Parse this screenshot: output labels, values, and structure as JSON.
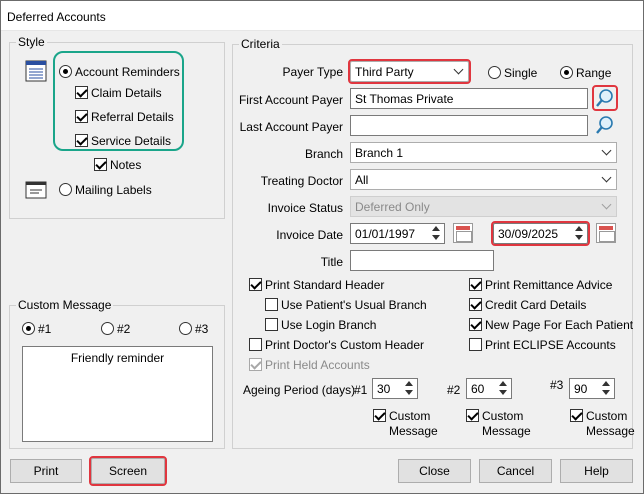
{
  "window": {
    "title": "Deferred Accounts"
  },
  "style": {
    "label": "Style",
    "account_reminders": "Account Reminders",
    "claim_details": "Claim Details",
    "referral_details": "Referral Details",
    "service_details": "Service Details",
    "notes": "Notes",
    "mailing_labels": "Mailing Labels"
  },
  "custom_message": {
    "label": "Custom Message",
    "opt1": "#1",
    "opt2": "#2",
    "opt3": "#3",
    "text": "Friendly reminder"
  },
  "criteria": {
    "label": "Criteria",
    "payer_type_label": "Payer Type",
    "payer_type_value": "Third Party",
    "single": "Single",
    "range": "Range",
    "first_account_payer_label": "First Account Payer",
    "first_account_payer_value": "St Thomas Private",
    "last_account_payer_label": "Last Account Payer",
    "last_account_payer_value": "",
    "branch_label": "Branch",
    "branch_value": "Branch 1",
    "treating_doctor_label": "Treating Doctor",
    "treating_doctor_value": "All",
    "invoice_status_label": "Invoice Status",
    "invoice_status_value": "Deferred Only",
    "invoice_date_label": "Invoice Date",
    "invoice_date_from": "01/01/1997",
    "invoice_date_to": "30/09/2025",
    "title_label": "Title",
    "title_value": "",
    "print_standard_header": "Print Standard Header",
    "use_patients_usual_branch": "Use Patient's Usual Branch",
    "use_login_branch": "Use Login Branch",
    "print_doctors_custom_header": "Print Doctor's Custom Header",
    "print_held_accounts": "Print Held Accounts",
    "print_remittance_advice": "Print Remittance Advice",
    "credit_card_details": "Credit Card Details",
    "new_page_for_each_patient": "New Page For Each Patient",
    "print_eclipse_accounts": "Print ECLIPSE Accounts",
    "ageing_label": "Ageing Period (days)",
    "ageing1_label": "#1",
    "ageing1_value": "30",
    "ageing2_label": "#2",
    "ageing2_value": "60",
    "ageing3_label": "#3",
    "ageing3_value": "90",
    "custom": "Custom",
    "message": "Message"
  },
  "buttons": {
    "print": "Print",
    "screen": "Screen",
    "close": "Close",
    "cancel": "Cancel",
    "help": "Help"
  },
  "colors": {
    "highlight_red": "#e0363f",
    "highlight_teal": "#1aa58a"
  }
}
